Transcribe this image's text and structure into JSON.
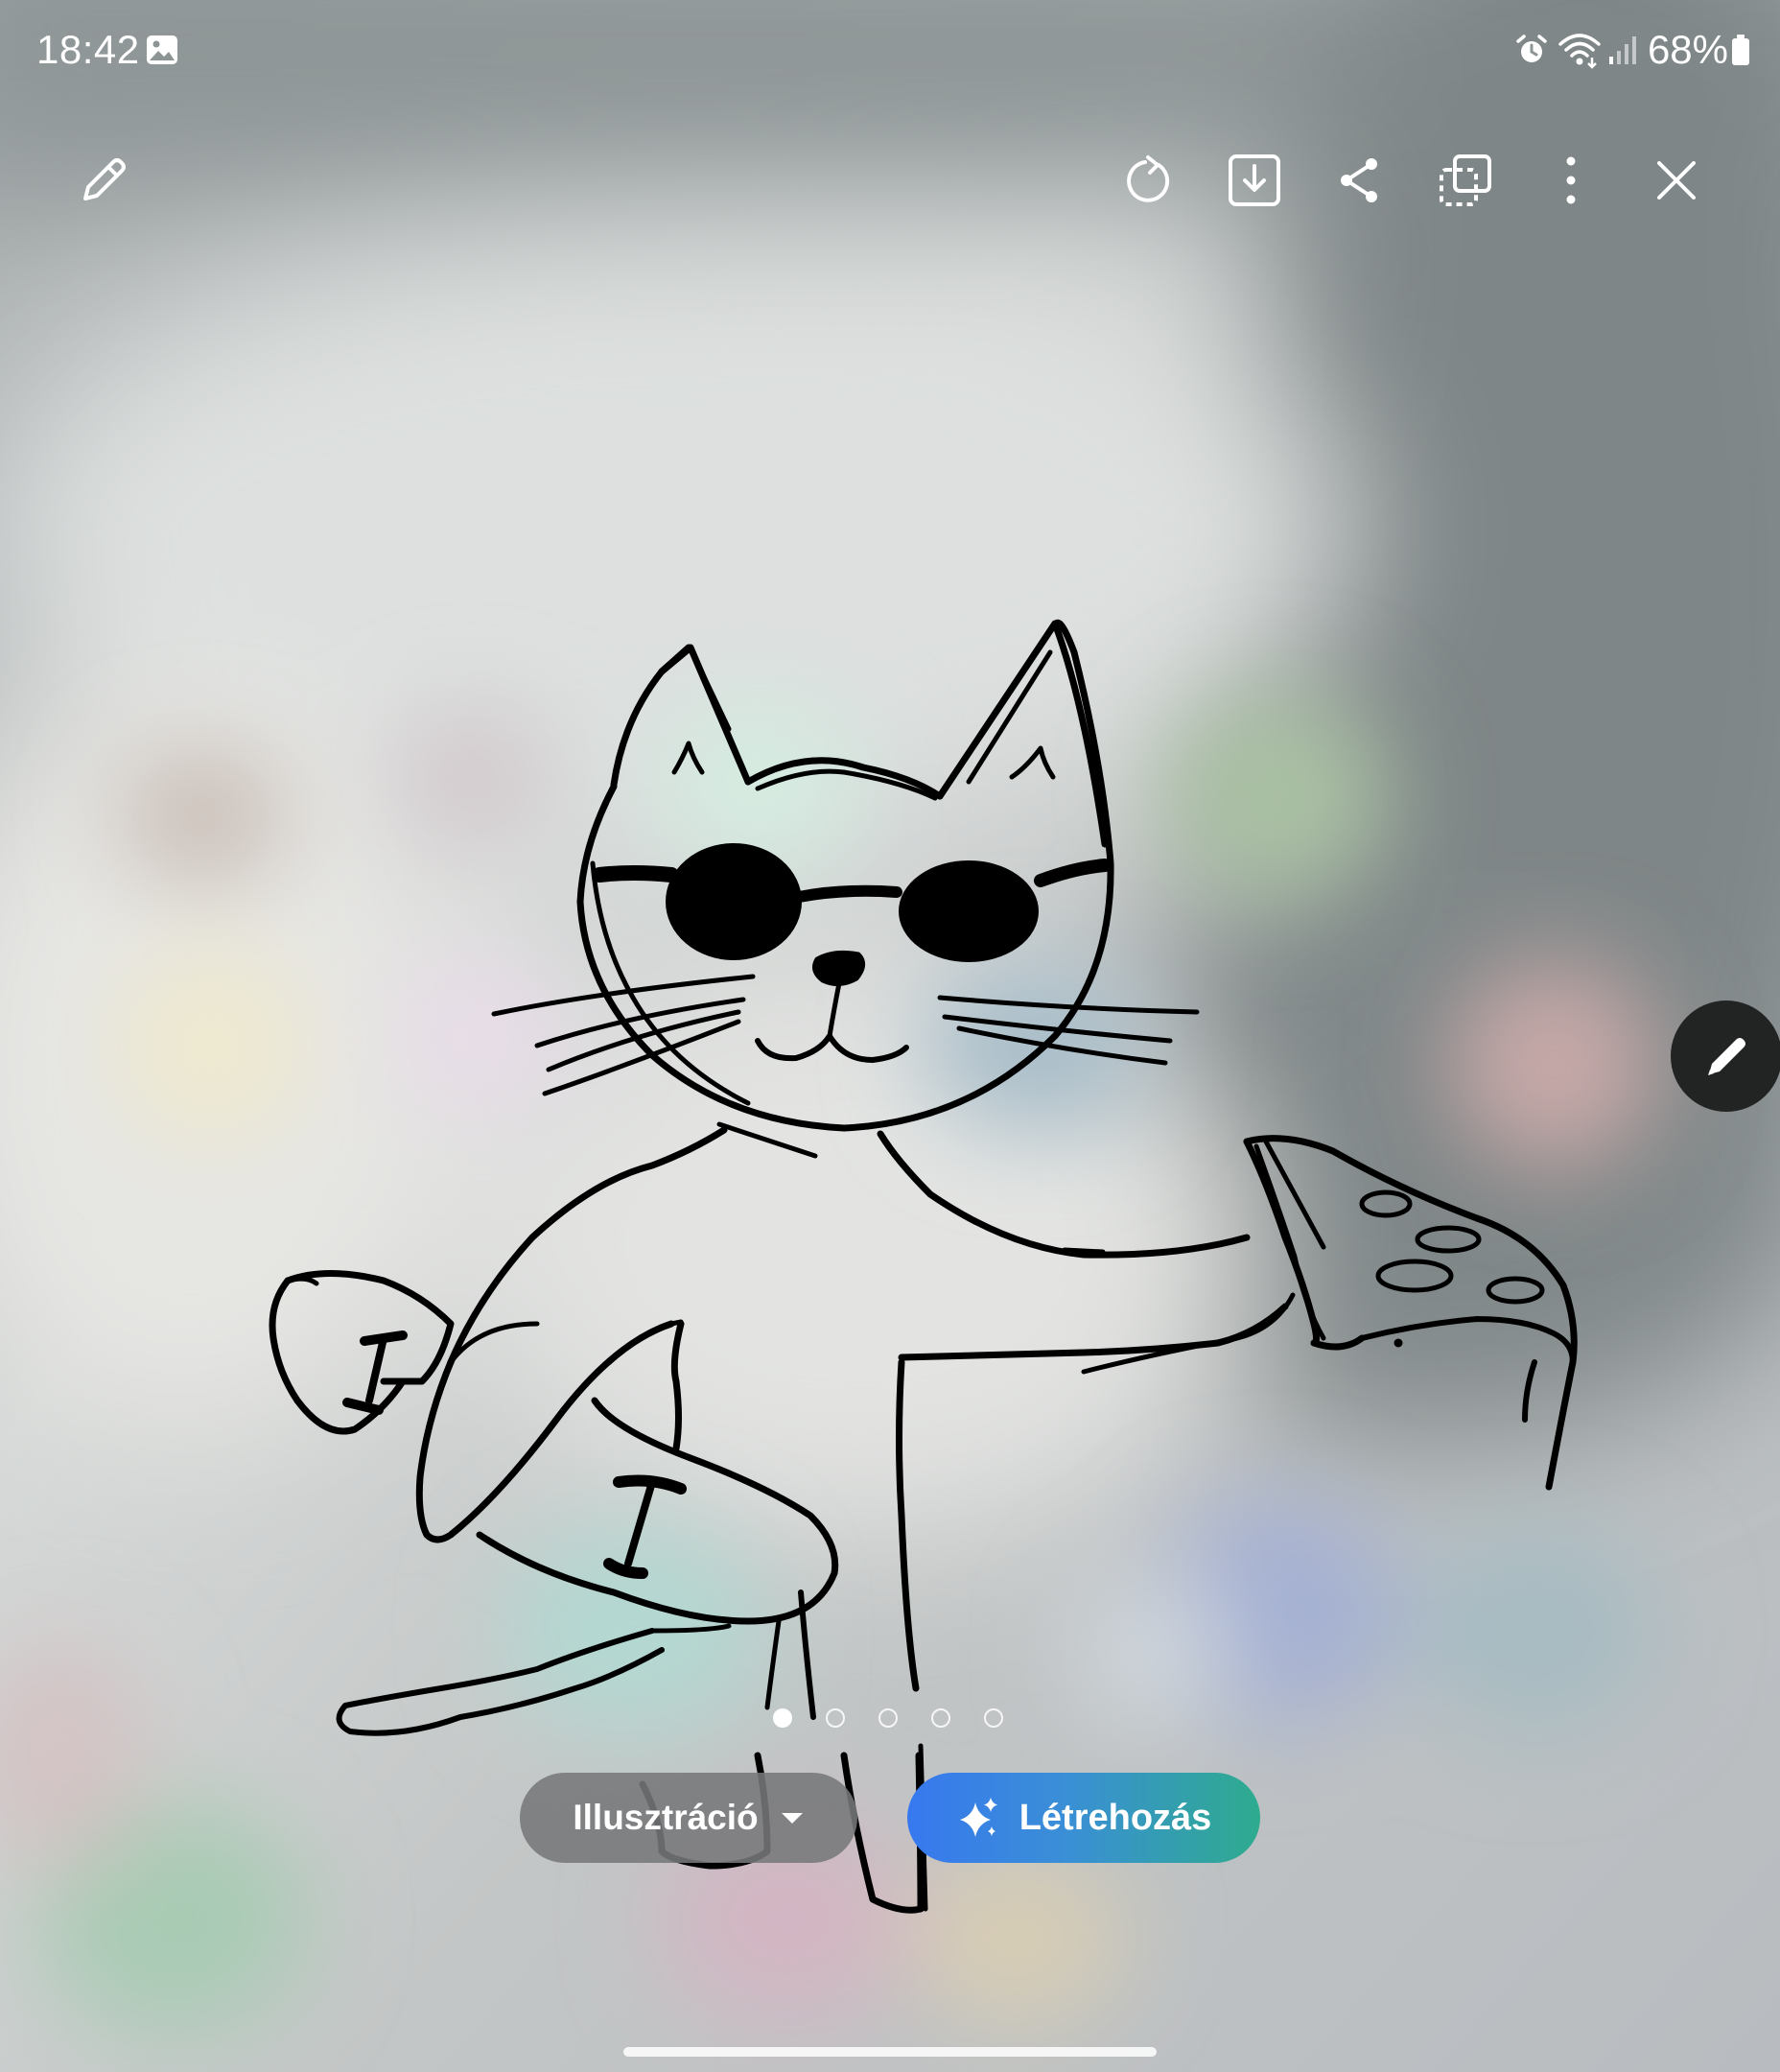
{
  "status_bar": {
    "time": "18:42",
    "battery_percent": "68%",
    "icons": [
      "gallery-icon",
      "alarm-icon",
      "wifi-icon",
      "signal-icon",
      "battery-icon"
    ]
  },
  "toolbar": {
    "left": [
      "pencil-icon"
    ],
    "right": [
      "redo-icon",
      "save-icon",
      "share-icon",
      "copy-icon",
      "more-icon",
      "close-icon"
    ]
  },
  "canvas": {
    "subject": "cat sketch with sunglasses, skateboard and pizza slice",
    "stroke_color": "#000000"
  },
  "pager": {
    "total": 5,
    "current": 1
  },
  "bottom_bar": {
    "style_label": "Illusztráció",
    "create_label": "Létrehozás"
  },
  "colors": {
    "create_gradient_start": "#3778ef",
    "create_gradient_end": "#2eab8e",
    "fab_background": "#222323"
  }
}
